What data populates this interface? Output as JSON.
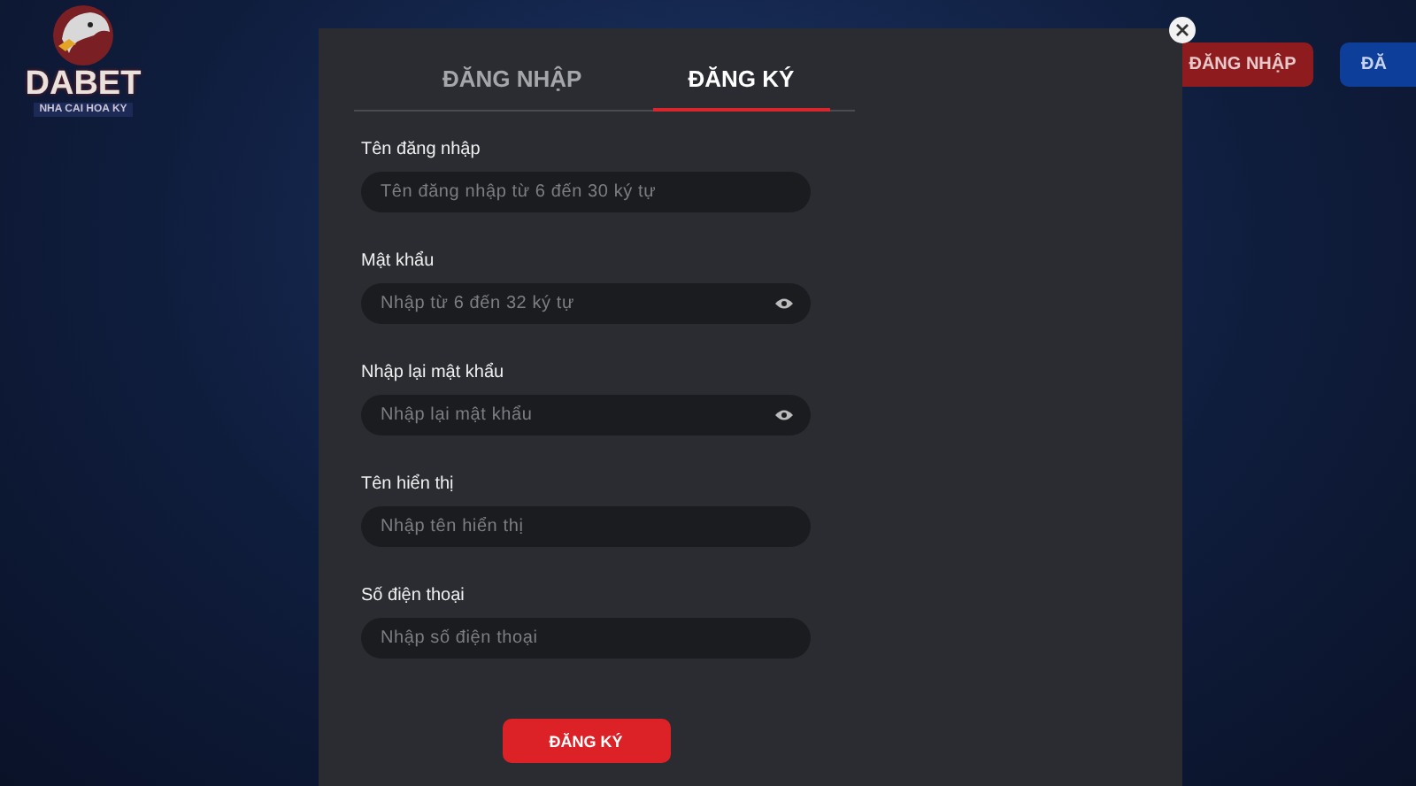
{
  "logo": {
    "name": "DABET",
    "tagline": "NHA CAI HOA KY"
  },
  "header_buttons": [
    {
      "label": "ĐĂNG NHẬP",
      "kind": "login"
    },
    {
      "label": "ĐĂ",
      "kind": "register"
    }
  ],
  "modal": {
    "tabs": [
      {
        "label": "ĐĂNG NHẬP",
        "selected": false
      },
      {
        "label": "ĐĂNG KÝ",
        "selected": true
      }
    ],
    "fields": [
      {
        "label": "Tên đăng nhập",
        "placeholder": "Tên đăng nhập từ 6 đến 30 ký tự",
        "kind": "text"
      },
      {
        "label": "Mật khẩu",
        "placeholder": "Nhập từ 6 đến 32 ký tự",
        "kind": "password"
      },
      {
        "label": "Nhập lại mật khẩu",
        "placeholder": "Nhập lại mật khẩu",
        "kind": "password"
      },
      {
        "label": "Tên hiển thị",
        "placeholder": "Nhập tên hiển thị",
        "kind": "text"
      },
      {
        "label": "Số điện thoại",
        "placeholder": "Nhập số điện thoại",
        "kind": "text"
      }
    ],
    "submit": "ĐĂNG KÝ"
  }
}
